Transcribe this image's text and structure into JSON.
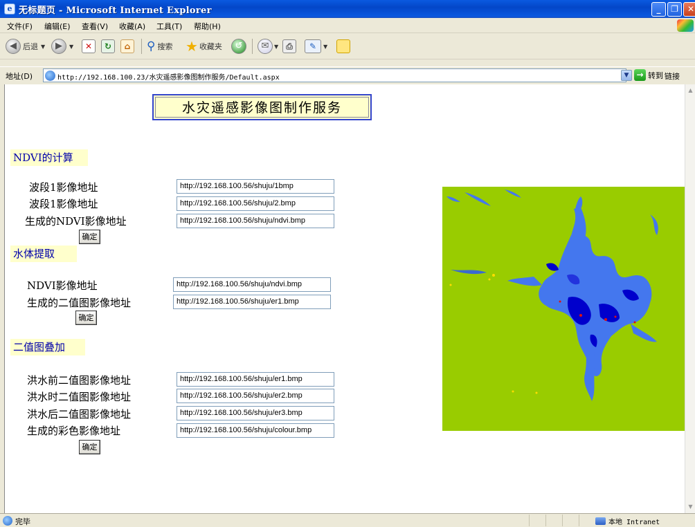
{
  "window": {
    "title": "无标题页 - Microsoft Internet Explorer",
    "icon": "ie-icon"
  },
  "menu": [
    "文件(F)",
    "编辑(E)",
    "查看(V)",
    "收藏(A)",
    "工具(T)",
    "帮助(H)"
  ],
  "toolbar": {
    "back": "后退",
    "search": "搜索",
    "favorites": "收藏夹"
  },
  "address": {
    "label": "地址(D)",
    "url": "http://192.168.100.23/水灾遥感影像图制作服务/Default.aspx",
    "go": "转到",
    "links": "链接"
  },
  "page": {
    "title": "水灾遥感影像图制作服务",
    "sections": [
      {
        "heading": "NDVI的计算",
        "fields": [
          {
            "label": "波段1影像地址",
            "value": "http://192.168.100.56/shuju/1bmp"
          },
          {
            "label": "波段1影像地址",
            "value": "http://192.168.100.56/shuju/2.bmp"
          },
          {
            "label": "生成的NDVI影像地址",
            "value": "http://192.168.100.56/shuju/ndvi.bmp"
          }
        ],
        "button": "确定"
      },
      {
        "heading": "水体提取",
        "fields": [
          {
            "label": "NDVI影像地址",
            "value": "http://192.168.100.56/shuju/ndvi.bmp"
          },
          {
            "label": "生成的二值图影像地址",
            "value": "http://192.168.100.56/shuju/er1.bmp"
          }
        ],
        "button": "确定"
      },
      {
        "heading": "二值图叠加",
        "fields": [
          {
            "label": "洪水前二值图影像地址",
            "value": "http://192.168.100.56/shuju/er1.bmp"
          },
          {
            "label": "洪水时二值图影像地址",
            "value": "http://192.168.100.56/shuju/er2.bmp"
          },
          {
            "label": "洪水后二值图影像地址",
            "value": "http://192.168.100.56/shuju/er3.bmp"
          },
          {
            "label": "生成的彩色影像地址",
            "value": "http://192.168.100.56/shuju/colour.bmp"
          }
        ],
        "button": "确定"
      }
    ],
    "map_colors": {
      "land": "#99cc00",
      "water": "#4477ee",
      "flood": "#0000cc"
    }
  },
  "status": {
    "text": "完毕",
    "zone": "本地 Intranet"
  }
}
